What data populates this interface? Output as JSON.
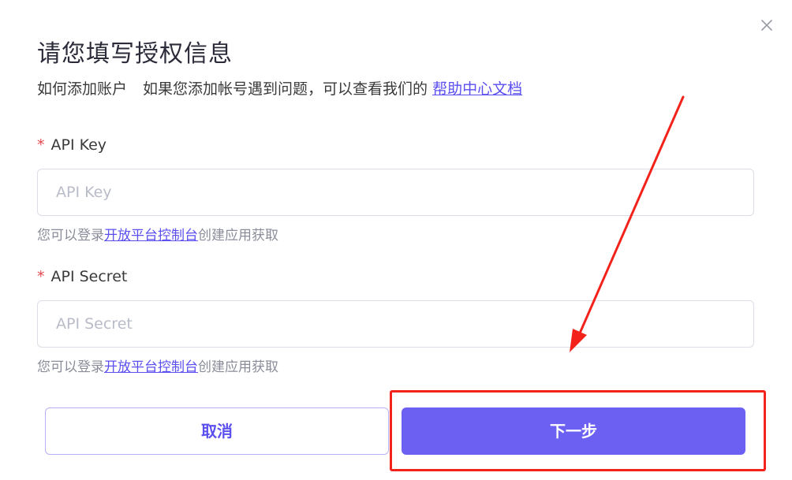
{
  "dialog": {
    "title": "请您填写授权信息",
    "subtitle_prefix": "如何添加账户",
    "subtitle_text": "如果您添加帐号遇到问题，可以查看我们的",
    "help_link": "帮助中心文档",
    "close_icon": "close-icon"
  },
  "fields": {
    "api_key": {
      "required_mark": "*",
      "label": "API Key",
      "value": "",
      "placeholder": "API Key",
      "hint_prefix": "您可以登录",
      "hint_link": "开放平台控制台",
      "hint_suffix": "创建应用获取"
    },
    "api_secret": {
      "required_mark": "*",
      "label": "API Secret",
      "value": "",
      "placeholder": "API Secret",
      "hint_prefix": "您可以登录",
      "hint_link": "开放平台控制台",
      "hint_suffix": "创建应用获取"
    }
  },
  "buttons": {
    "cancel": "取消",
    "next": "下一步"
  },
  "colors": {
    "accent": "#6c60f3",
    "link": "#5b4ff0",
    "required": "#e5484d",
    "annotation": "#f3221b"
  }
}
